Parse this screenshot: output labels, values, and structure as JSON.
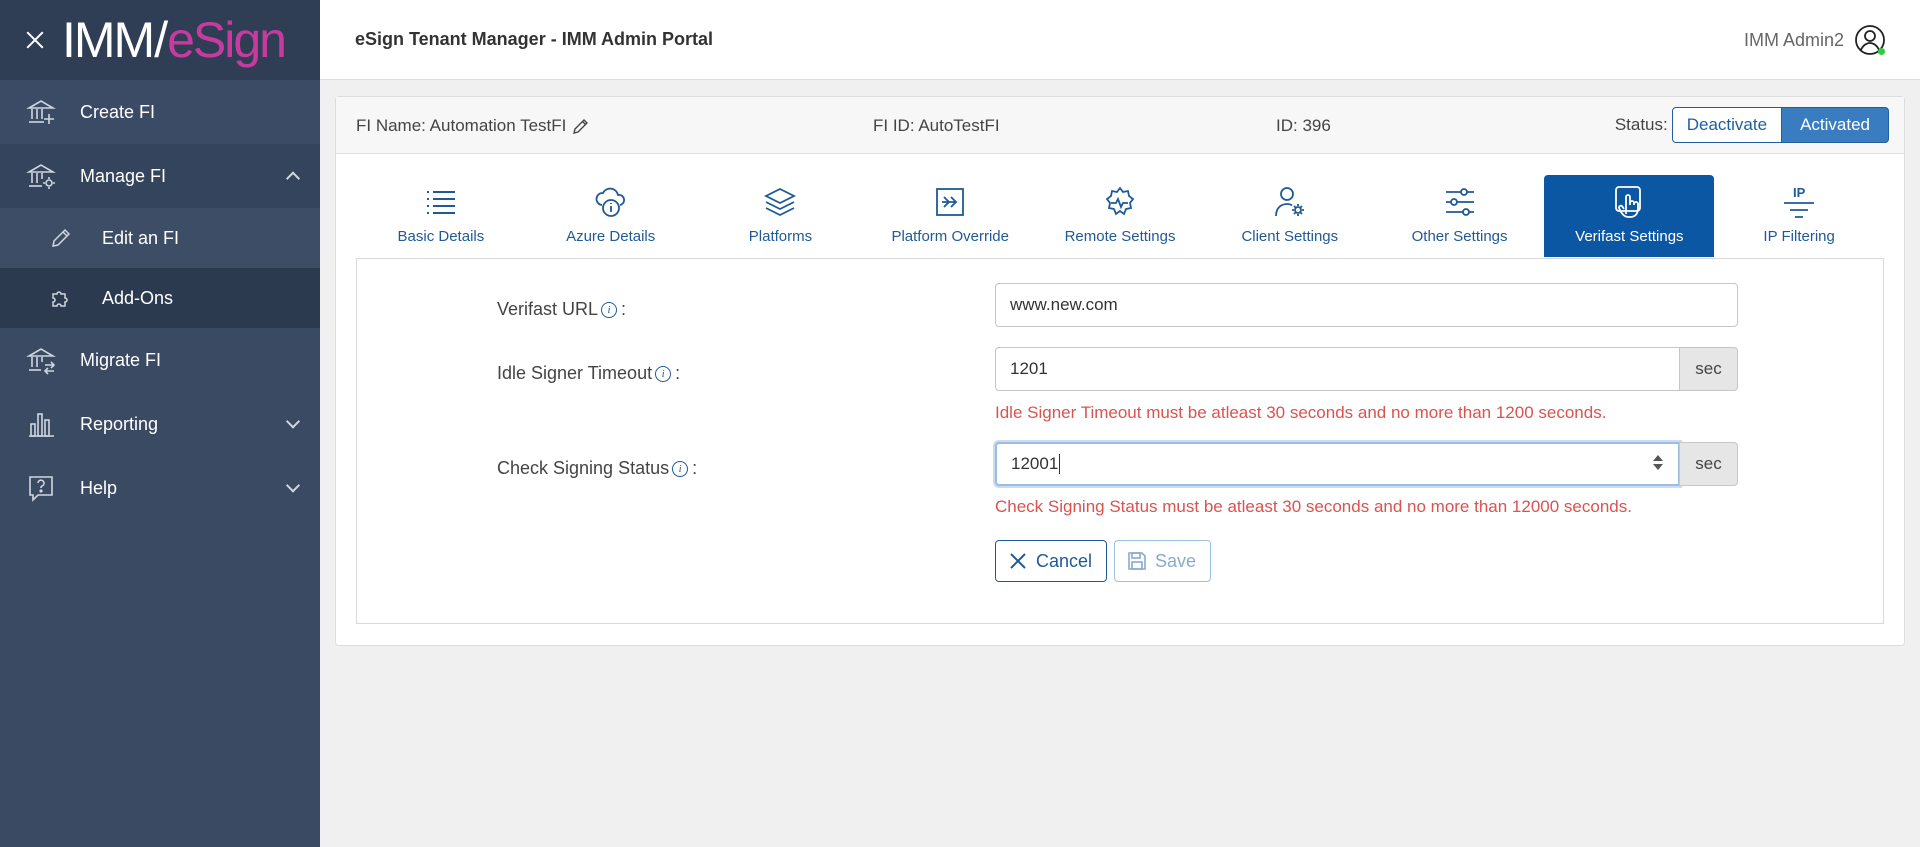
{
  "sidebar": {
    "logo_imm": "IMM",
    "logo_esign": "eSign",
    "items": {
      "create_fi": "Create FI",
      "manage_fi": "Manage FI",
      "edit_fi": "Edit an FI",
      "add_ons": "Add-Ons",
      "migrate_fi": "Migrate FI",
      "reporting": "Reporting",
      "help": "Help"
    }
  },
  "header": {
    "title": "eSign Tenant Manager - IMM Admin Portal",
    "user": "IMM Admin2"
  },
  "fi_bar": {
    "fi_name": "FI Name: Automation TestFI",
    "fi_id": "FI ID: AutoTestFI",
    "id": "ID: 396",
    "status_label": "Status:",
    "deactivate": "Deactivate",
    "activated": "Activated"
  },
  "tabs": {
    "basic": "Basic Details",
    "azure": "Azure Details",
    "platforms": "Platforms",
    "override": "Platform Override",
    "remote": "Remote Settings",
    "client": "Client Settings",
    "other": "Other Settings",
    "verifast": "Verifast Settings",
    "ip_icon_text": "IP",
    "ip": "IP Filtering"
  },
  "form": {
    "verifast_url_label": "Verifast URL",
    "verifast_url_value": "www.new.com",
    "idle_label": "Idle Signer Timeout",
    "idle_value": "1201",
    "idle_unit": "sec",
    "idle_error": "Idle Signer Timeout must be atleast 30 seconds and no more than 1200 seconds.",
    "check_label": "Check Signing Status",
    "check_value": "12001",
    "check_unit": "sec",
    "check_error": "Check Signing Status must be atleast 30 seconds and no more than 12000 seconds.",
    "colon": ":",
    "info_glyph": "i",
    "cancel": "Cancel",
    "save": "Save"
  }
}
